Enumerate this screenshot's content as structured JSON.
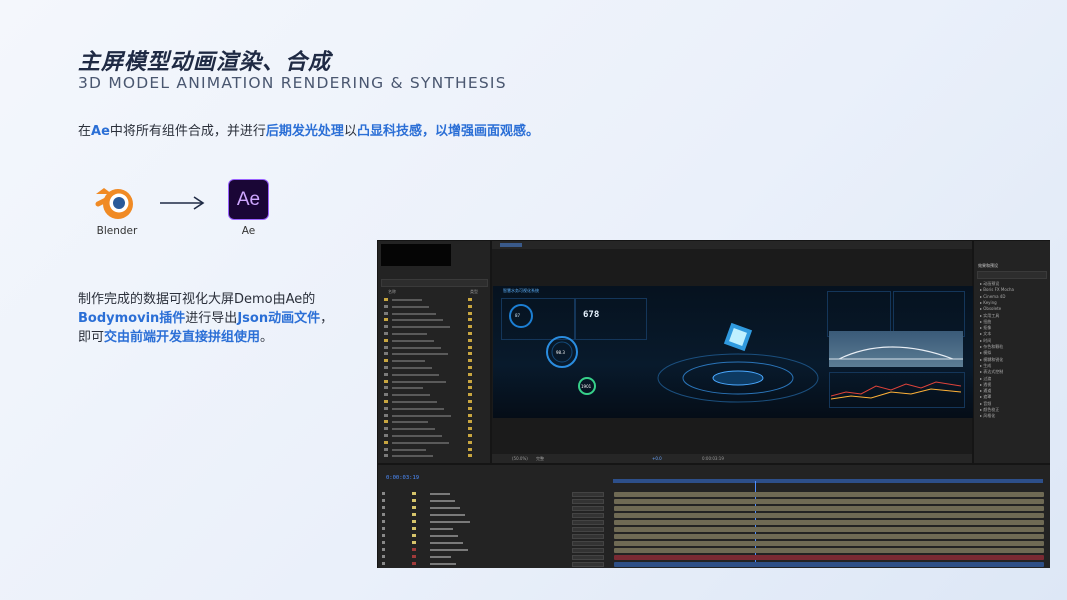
{
  "header": {
    "title": "主屏模型动画渲染、合成",
    "subtitle": "3D MODEL ANIMATION RENDERING & SYNTHESIS"
  },
  "intro": {
    "p1": "在",
    "p2": "Ae",
    "p3": "中将所有组件合成，并进行",
    "p4": "后期发光处理",
    "p5": "以",
    "p6": "凸显科技感",
    "p7": "，以增强画面观感。"
  },
  "flow": {
    "blender_label": "Blender",
    "ae_text": "Ae",
    "ae_label": "Ae"
  },
  "description": {
    "d1": "制作完成的数据可视化大屏Demo由Ae的",
    "d2": "Bodymovin插件",
    "d3": "进行导出",
    "d4": "Json动画文件",
    "d5": "，",
    "d6": "即可",
    "d7": "交由前端开发直接拼组使用",
    "d8": "。"
  },
  "ae_ui": {
    "timecode": "0:00:03:19",
    "dashboard_title": "智慧水务可视化系统",
    "counter": "678",
    "gauge_a": "87",
    "gauge_b": "98.3",
    "gauge_c": "1901",
    "zoom": "(50.0%)",
    "quality": "完整",
    "offset": "+0.0",
    "time_right": "0:00:03:19",
    "project_header_name": "名称",
    "project_header_type": "类型",
    "effects_panel": "效果和预设",
    "effects_items": [
      "动画预设",
      "Boris FX Mocha",
      "Cinema 4D",
      "Keying",
      "Obsolete",
      "实用工具",
      "扭曲",
      "抠像",
      "文本",
      "时间",
      "杂色和颗粒",
      "模拟",
      "模糊和锐化",
      "生成",
      "表达式控制",
      "过渡",
      "透视",
      "通道",
      "遮罩",
      "音频",
      "颜色校正",
      "风格化"
    ]
  },
  "colors": {
    "accent": "#2b6fd6",
    "ae_purple": "#9a62ff",
    "ae_bg": "#1a0636",
    "timeline_olive": "#6f6a54",
    "timeline_red": "#7a2a33",
    "timeline_blue": "#2e4f86"
  }
}
